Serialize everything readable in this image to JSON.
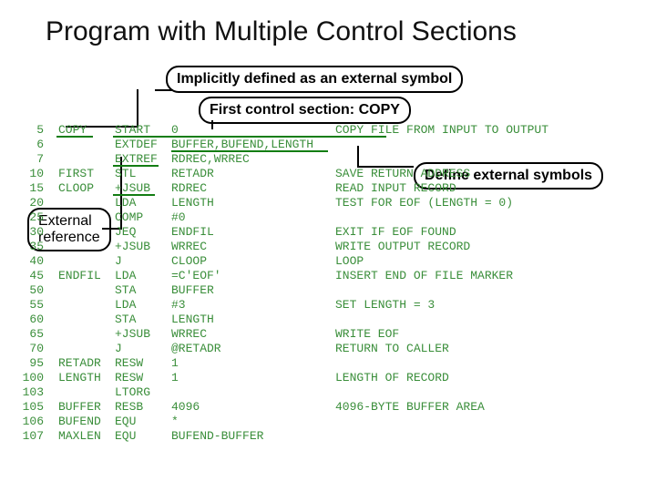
{
  "title": "Program with Multiple Control Sections",
  "callouts": {
    "implicit": "Implicitly defined as an external symbol",
    "first_section": "First control section: COPY",
    "define_ext": "Define external symbols",
    "ext_ref": "External reference"
  },
  "rows": [
    {
      "ln": "5",
      "lbl": "COPY",
      "op": "START",
      "arg": "0",
      "cmt": "COPY FILE FROM INPUT TO OUTPUT"
    },
    {
      "ln": "6",
      "lbl": "",
      "op": "EXTDEF",
      "arg": "BUFFER,BUFEND,LENGTH",
      "cmt": ""
    },
    {
      "ln": "7",
      "lbl": "",
      "op": "EXTREF",
      "arg": "RDREC,WRREC",
      "cmt": ""
    },
    {
      "ln": "10",
      "lbl": "FIRST",
      "op": "STL",
      "arg": "RETADR",
      "cmt": "SAVE RETURN ADDRESS"
    },
    {
      "ln": "15",
      "lbl": "CLOOP",
      "op": "+JSUB",
      "arg": "RDREC",
      "cmt": "READ INPUT RECORD"
    },
    {
      "ln": "20",
      "lbl": "",
      "op": "LDA",
      "arg": "LENGTH",
      "cmt": "TEST FOR EOF (LENGTH = 0)"
    },
    {
      "ln": "25",
      "lbl": "",
      "op": "COMP",
      "arg": "#0",
      "cmt": ""
    },
    {
      "ln": "30",
      "lbl": "",
      "op": "JEQ",
      "arg": "ENDFIL",
      "cmt": "EXIT IF EOF FOUND"
    },
    {
      "ln": "35",
      "lbl": "",
      "op": "+JSUB",
      "arg": "WRREC",
      "cmt": "WRITE OUTPUT RECORD"
    },
    {
      "ln": "40",
      "lbl": "",
      "op": "J",
      "arg": "CLOOP",
      "cmt": "LOOP"
    },
    {
      "ln": "45",
      "lbl": "ENDFIL",
      "op": "LDA",
      "arg": "=C'EOF'",
      "cmt": "INSERT END OF FILE MARKER"
    },
    {
      "ln": "50",
      "lbl": "",
      "op": "STA",
      "arg": "BUFFER",
      "cmt": ""
    },
    {
      "ln": "55",
      "lbl": "",
      "op": "LDA",
      "arg": "#3",
      "cmt": "SET LENGTH = 3"
    },
    {
      "ln": "60",
      "lbl": "",
      "op": "STA",
      "arg": "LENGTH",
      "cmt": ""
    },
    {
      "ln": "65",
      "lbl": "",
      "op": "+JSUB",
      "arg": "WRREC",
      "cmt": "WRITE EOF"
    },
    {
      "ln": "70",
      "lbl": "",
      "op": "J",
      "arg": "@RETADR",
      "cmt": "RETURN TO CALLER"
    },
    {
      "ln": "95",
      "lbl": "RETADR",
      "op": "RESW",
      "arg": "1",
      "cmt": ""
    },
    {
      "ln": "100",
      "lbl": "LENGTH",
      "op": "RESW",
      "arg": "1",
      "cmt": "LENGTH OF RECORD"
    },
    {
      "ln": "103",
      "lbl": "",
      "op": "LTORG",
      "arg": "",
      "cmt": ""
    },
    {
      "ln": "105",
      "lbl": "BUFFER",
      "op": "RESB",
      "arg": "4096",
      "cmt": "4096-BYTE BUFFER AREA"
    },
    {
      "ln": "106",
      "lbl": "BUFEND",
      "op": "EQU",
      "arg": "*",
      "cmt": ""
    },
    {
      "ln": "107",
      "lbl": "MAXLEN",
      "op": "EQU",
      "arg": "BUFEND-BUFFER",
      "cmt": ""
    }
  ]
}
